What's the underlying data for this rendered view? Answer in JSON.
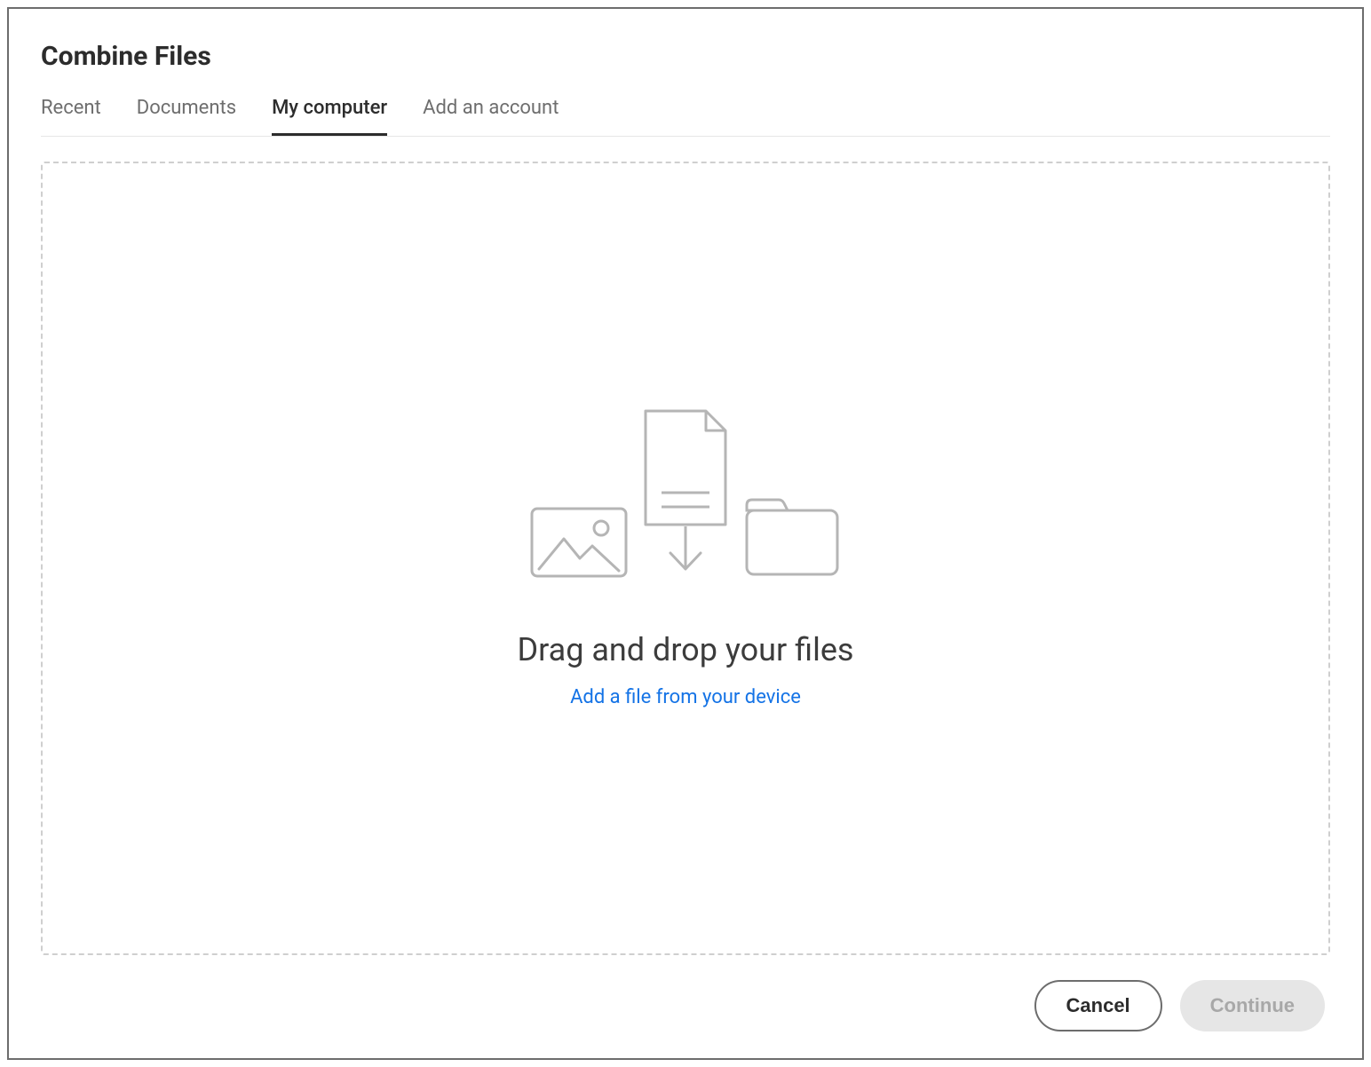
{
  "header": {
    "title": "Combine Files"
  },
  "tabs": [
    {
      "label": "Recent",
      "active": false
    },
    {
      "label": "Documents",
      "active": false
    },
    {
      "label": "My computer",
      "active": true
    },
    {
      "label": "Add an account",
      "active": false
    }
  ],
  "dropzone": {
    "title": "Drag and drop your files",
    "link": "Add a file from your device"
  },
  "footer": {
    "cancel": "Cancel",
    "continue": "Continue"
  }
}
